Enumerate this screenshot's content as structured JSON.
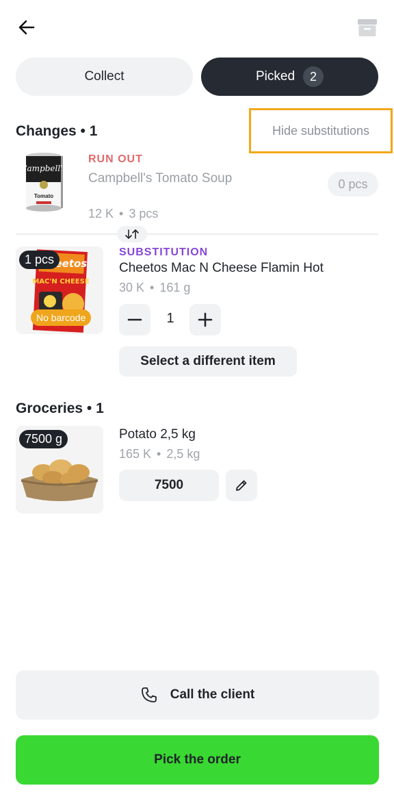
{
  "header": {
    "back_icon": "arrow-left-icon",
    "archive_icon": "archive-box-icon"
  },
  "tabs": [
    {
      "label": "Collect",
      "active": false
    },
    {
      "label": "Picked",
      "active": true,
      "count": "2"
    }
  ],
  "changes": {
    "title": "Changes • 1",
    "hide_label": "Hide substitutions",
    "original": {
      "tag": "RUN OUT",
      "name": "Campbell's Tomato Soup",
      "price": "12 K",
      "amount": "3 pcs",
      "picked": "0 pcs"
    },
    "substitution": {
      "tag": "SUBSTITUTION",
      "name": "Cheetos Mac N Cheese Flamin Hot",
      "price": "30 K",
      "amount": "161 g",
      "qty_badge": "1 pcs",
      "barcode_badge": "No barcode",
      "quantity": "1",
      "select_label": "Select a different item"
    }
  },
  "groceries": {
    "title": "Groceries • 1",
    "item": {
      "name": "Potato 2,5 kg",
      "price": "165 K",
      "amount": "2,5 kg",
      "weight_badge": "7500 g",
      "weight_value": "7500"
    }
  },
  "actions": {
    "call_label": "Call the client",
    "pick_label": "Pick the order"
  },
  "colors": {
    "accent_green": "#39d832",
    "dark_tab": "#262b33",
    "runout_red": "#e06a6a",
    "substitution_purple": "#8747d8",
    "highlight_orange": "#f2a81a"
  }
}
